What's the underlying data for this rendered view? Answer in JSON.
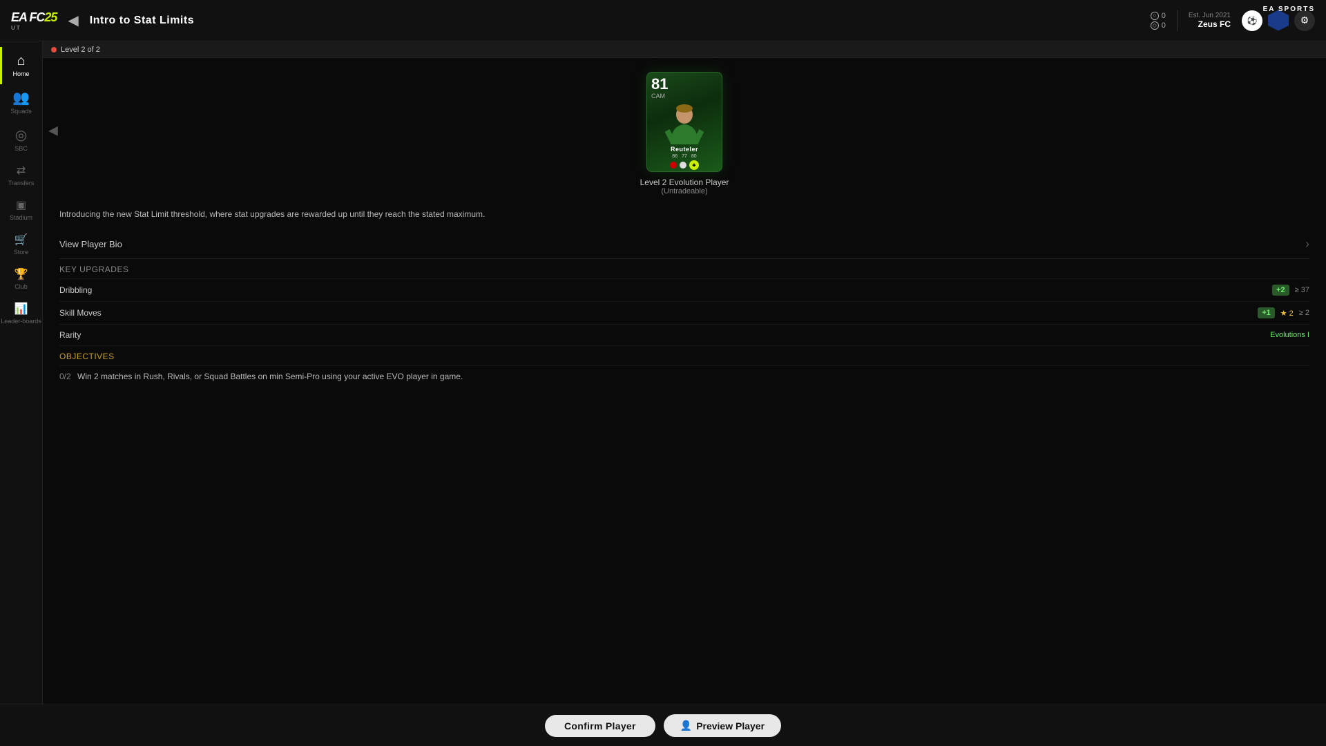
{
  "app": {
    "logo_text": "EA FC",
    "logo_year": "25",
    "ut_label": "UT",
    "ea_sports": "EA SPORTS"
  },
  "header": {
    "back_label": "◀",
    "page_title": "Intro to Stat Limits",
    "level_indicator": "Level 2 of 2",
    "stats": {
      "coins_icon": "○",
      "coins_value": "0",
      "points_icon": "◇",
      "points_value": "0"
    },
    "club_info": {
      "est_label": "Est. Jun 2021",
      "club_name": "Zeus FC"
    }
  },
  "sidebar": {
    "items": [
      {
        "id": "home",
        "label": "Home",
        "icon": "⌂",
        "active": true
      },
      {
        "id": "squads",
        "label": "Squads",
        "icon": "👥"
      },
      {
        "id": "sbc",
        "label": "SBC",
        "icon": "◎"
      },
      {
        "id": "transfers",
        "label": "Transfers",
        "icon": "⇄"
      },
      {
        "id": "stadium",
        "label": "Stadium",
        "icon": "🏟"
      },
      {
        "id": "store",
        "label": "Store",
        "icon": "🛒"
      },
      {
        "id": "club",
        "label": "Club",
        "icon": "🏆"
      },
      {
        "id": "leaderboards",
        "label": "Leaderboards",
        "icon": "📊"
      }
    ],
    "settings": {
      "id": "settings",
      "label": "Settings",
      "icon": "⚙"
    }
  },
  "player_card": {
    "rating": "81",
    "position": "CAM",
    "name": "Reuteler",
    "label": "Level 2 Evolution Player",
    "sublabel": "(Untradeable)"
  },
  "content": {
    "intro_text": "Introducing the new Stat Limit threshold, where stat upgrades are rewarded up until they reach the stated maximum.",
    "view_bio_label": "View Player Bio",
    "key_upgrades_label": "Key Upgrades",
    "upgrades": [
      {
        "name": "Dribbling",
        "badge": "+2",
        "stat": "37"
      },
      {
        "name": "Skill Moves",
        "badge": "+1",
        "stars": "★ 2",
        "stat": "2"
      },
      {
        "name": "Rarity",
        "rarity_value": "Evolutions I"
      }
    ],
    "objectives_label": "Objectives",
    "objectives": [
      {
        "progress": "0/2",
        "text": "Win 2 matches in Rush, Rivals, or Squad Battles on min Semi-Pro using your active EVO player in game."
      }
    ]
  },
  "bottom_bar": {
    "confirm_label": "Confirm Player",
    "preview_label": "Preview Player",
    "preview_icon": "👤"
  }
}
